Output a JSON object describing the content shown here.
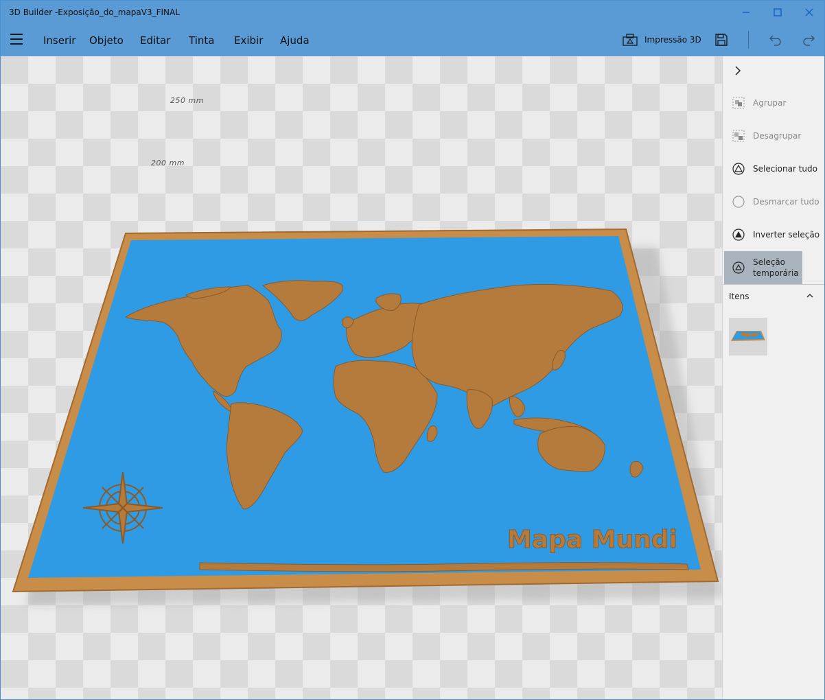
{
  "window": {
    "title": "3D Builder -Exposição_do_mapaV3_FINAL"
  },
  "menu": {
    "items": [
      "Inserir",
      "Objeto",
      "Editar",
      "Tinta",
      "Exibir",
      "Ajuda"
    ],
    "print_label": "Impressão 3D"
  },
  "viewport": {
    "dim_labels": [
      "250 mm",
      "200 mm"
    ],
    "model_text": "Mapa Mundi",
    "colors": {
      "sea": "#2f9be4",
      "land": "#b57b3c",
      "frame": "#c98d4a"
    }
  },
  "sidepanel": {
    "actions": [
      {
        "label": "Agrupar",
        "icon": "group-icon",
        "state": "disabled"
      },
      {
        "label": "Desagrupar",
        "icon": "ungroup-icon",
        "state": "disabled"
      },
      {
        "label": "Selecionar tudo",
        "icon": "select-all-icon",
        "state": "enabled"
      },
      {
        "label": "Desmarcar tudo",
        "icon": "deselect-all-icon",
        "state": "disabled"
      },
      {
        "label": "Inverter seleção",
        "icon": "invert-selection-icon",
        "state": "enabled"
      },
      {
        "label": "Seleção temporária",
        "icon": "temporary-selection-icon",
        "state": "active"
      }
    ],
    "items_header": "Itens"
  }
}
